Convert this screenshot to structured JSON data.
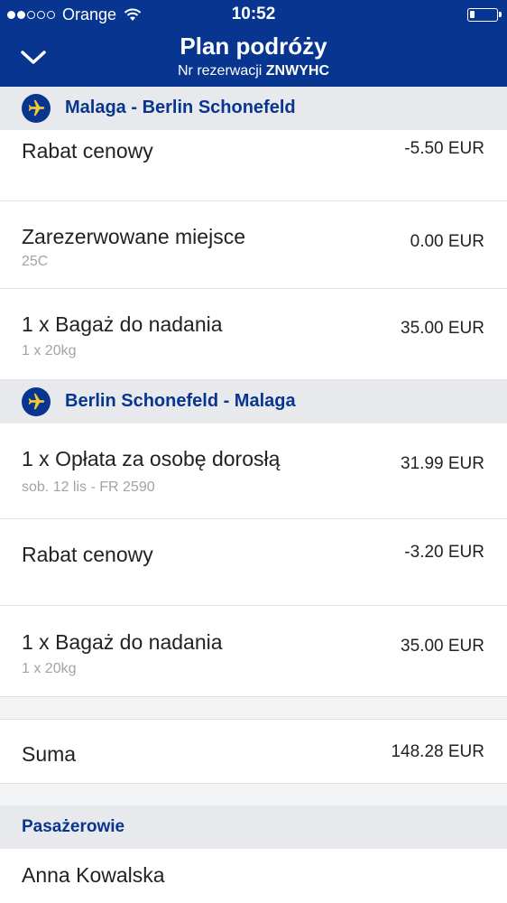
{
  "status_bar": {
    "carrier": "Orange",
    "time": "10:52",
    "signal_bars_filled": 2,
    "signal_bars_total": 5
  },
  "header": {
    "title": "Plan podróży",
    "reservation_label": "Nr rezerwacji",
    "reservation_code": "ZNWYHC",
    "back_icon": "chevron-down-icon"
  },
  "flights": [
    {
      "route": "Malaga - Berlin Schonefeld",
      "icon": "plane-icon",
      "items": [
        {
          "label": "Rabat cenowy",
          "sub": "",
          "price": "-5.50 EUR"
        },
        {
          "label": "Zarezerwowane miejsce",
          "sub": "25C",
          "price": "0.00 EUR"
        },
        {
          "label": "1 x Bagaż do nadania",
          "sub": "1 x 20kg",
          "price": "35.00 EUR"
        }
      ]
    },
    {
      "route": "Berlin Schonefeld - Malaga",
      "icon": "plane-icon",
      "items": [
        {
          "label": "1 x Opłata za osobę dorosłą",
          "sub": "sob. 12 lis - FR 2590",
          "price": "31.99 EUR"
        },
        {
          "label": "Rabat cenowy",
          "sub": "",
          "price": "-3.20 EUR"
        },
        {
          "label": "1 x Bagaż do nadania",
          "sub": "1 x 20kg",
          "price": "35.00 EUR"
        }
      ]
    }
  ],
  "total": {
    "label": "Suma",
    "price": "148.28 EUR"
  },
  "passengers": {
    "title": "Pasażerowie",
    "names": [
      "Anna Kowalska"
    ]
  },
  "colors": {
    "brand": "#073590",
    "section_bg": "#e8e9ec",
    "gap_bg": "#f3f4f6",
    "subtext": "#a3a3a3"
  }
}
